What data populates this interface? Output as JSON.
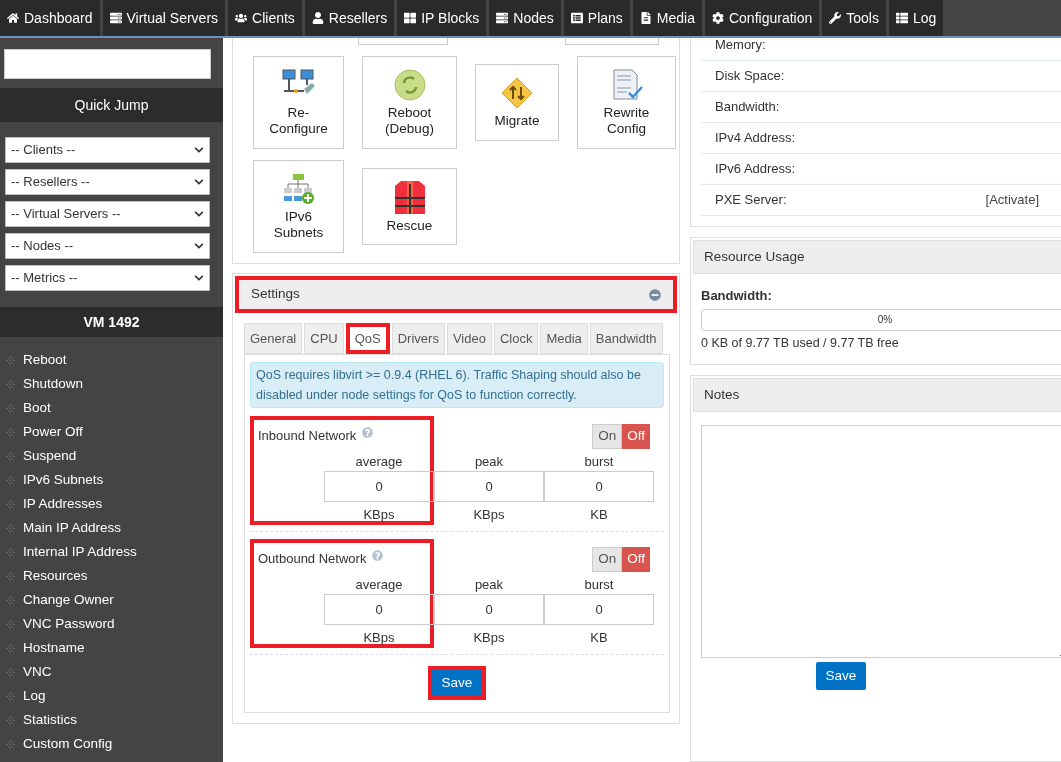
{
  "nav": [
    {
      "label": "Dashboard"
    },
    {
      "label": "Virtual Servers"
    },
    {
      "label": "Clients"
    },
    {
      "label": "Resellers"
    },
    {
      "label": "IP Blocks"
    },
    {
      "label": "Nodes"
    },
    {
      "label": "Plans"
    },
    {
      "label": "Media"
    },
    {
      "label": "Configuration"
    },
    {
      "label": "Tools"
    },
    {
      "label": "Log"
    }
  ],
  "sidebar": {
    "quick_jump_title": "Quick Jump",
    "selects": [
      {
        "value": "-- Clients --"
      },
      {
        "value": "-- Resellers --"
      },
      {
        "value": "-- Virtual Servers --"
      },
      {
        "value": "-- Nodes --"
      },
      {
        "value": "-- Metrics --"
      }
    ],
    "vm_title": "VM 1492",
    "items": [
      {
        "label": "Reboot"
      },
      {
        "label": "Shutdown"
      },
      {
        "label": "Boot"
      },
      {
        "label": "Power Off"
      },
      {
        "label": "Suspend"
      },
      {
        "label": "IPv6 Subnets"
      },
      {
        "label": "IP Addresses"
      },
      {
        "label": "Main IP Address"
      },
      {
        "label": "Internal IP Address"
      },
      {
        "label": "Resources"
      },
      {
        "label": "Change Owner"
      },
      {
        "label": "VNC Password"
      },
      {
        "label": "Hostname"
      },
      {
        "label": "VNC"
      },
      {
        "label": "Log"
      },
      {
        "label": "Statistics"
      },
      {
        "label": "Custom Config"
      }
    ]
  },
  "actions": [
    {
      "label": "Re-\nConfigure"
    },
    {
      "label": "Reboot\n(Debug)"
    },
    {
      "label": "Migrate"
    },
    {
      "label": "Rewrite\nConfig"
    },
    {
      "label": "IPv6\nSubnets"
    },
    {
      "label": "Rescue"
    }
  ],
  "settings": {
    "title": "Settings",
    "highlighted": true,
    "tabs": [
      {
        "label": "General",
        "selected": false,
        "highlighted": false
      },
      {
        "label": "CPU",
        "selected": false,
        "highlighted": false
      },
      {
        "label": "QoS",
        "selected": true,
        "highlighted": true
      },
      {
        "label": "Drivers",
        "selected": false,
        "highlighted": false
      },
      {
        "label": "Video",
        "selected": false,
        "highlighted": false
      },
      {
        "label": "Clock",
        "selected": false,
        "highlighted": false
      },
      {
        "label": "Media",
        "selected": false,
        "highlighted": false
      },
      {
        "label": "Bandwidth",
        "selected": false,
        "highlighted": false
      }
    ],
    "alert": "QoS requires libvirt >= 0.9.4 (RHEL 6). Traffic Shaping should also be disabled under node settings for QoS to function correctly.",
    "groups": [
      {
        "title": "Inbound Network",
        "highlighted": true,
        "on": false,
        "on_label": "On",
        "off_label": "Off",
        "fields": [
          {
            "header": "average",
            "value": "0",
            "unit": "KBps"
          },
          {
            "header": "peak",
            "value": "0",
            "unit": "KBps"
          },
          {
            "header": "burst",
            "value": "0",
            "unit": "KB"
          }
        ]
      },
      {
        "title": "Outbound Network",
        "highlighted": true,
        "on": false,
        "on_label": "On",
        "off_label": "Off",
        "fields": [
          {
            "header": "average",
            "value": "0",
            "unit": "KBps"
          },
          {
            "header": "peak",
            "value": "0",
            "unit": "KBps"
          },
          {
            "header": "burst",
            "value": "0",
            "unit": "KB"
          }
        ]
      }
    ],
    "save": {
      "label": "Save",
      "highlighted": true
    }
  },
  "info_rows": [
    {
      "label": "Memory:"
    },
    {
      "label": "Disk Space:"
    },
    {
      "label": "Bandwidth:"
    },
    {
      "label": "IPv4 Address:"
    },
    {
      "label": "IPv6 Address:"
    },
    {
      "label": "PXE Server:",
      "action": "[Activate]"
    }
  ],
  "resource_usage": {
    "title": "Resource Usage",
    "label": "Bandwidth:",
    "level": 0,
    "reading": "0%",
    "summary": "0 KB of 9.77 TB used / 9.77 TB free"
  },
  "notes": {
    "title": "Notes",
    "save": "Save"
  }
}
